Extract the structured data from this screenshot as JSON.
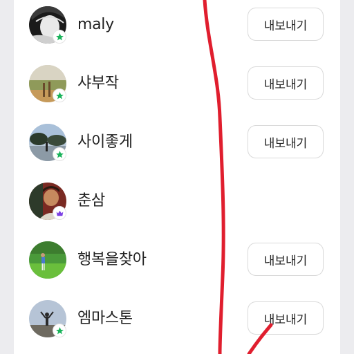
{
  "users": [
    {
      "name": "maly",
      "badge": "star-badge-icon",
      "button_label": "내보내기",
      "has_button": true
    },
    {
      "name": "샤부작",
      "badge": "star-badge-icon",
      "button_label": "내보내기",
      "has_button": true
    },
    {
      "name": "사이좋게",
      "badge": "star-badge-icon",
      "button_label": "내보내기",
      "has_button": true
    },
    {
      "name": "춘삼",
      "badge": "crown-badge-icon",
      "button_label": "",
      "has_button": false
    },
    {
      "name": "행복을찾아",
      "badge": "",
      "button_label": "내보내기",
      "has_button": true
    },
    {
      "name": "엠마스톤",
      "badge": "star-badge-icon",
      "button_label": "내보내기",
      "has_button": true
    }
  ],
  "colors": {
    "star_badge": "#19b35a",
    "crown_badge": "#7b3fe4",
    "annotation": "#e01e2e"
  }
}
